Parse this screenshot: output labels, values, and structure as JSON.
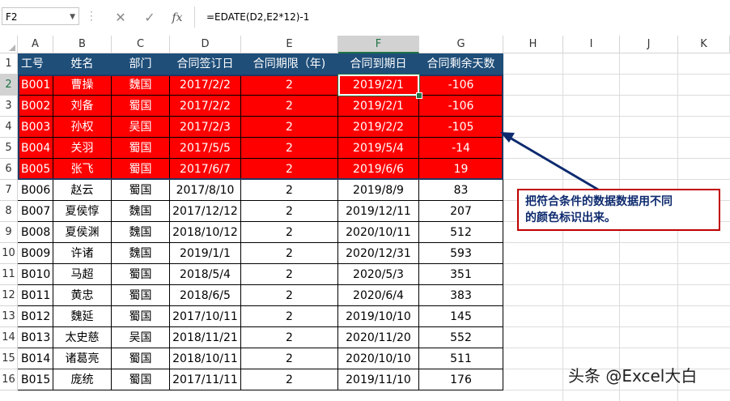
{
  "formula_bar": {
    "name_box": "F2",
    "cancel_icon": "✕",
    "enter_icon": "✓",
    "fx_label": "fx",
    "formula": "=EDATE(D2,E2*12)-1"
  },
  "columns": [
    "A",
    "B",
    "C",
    "D",
    "E",
    "F",
    "G",
    "H",
    "I",
    "J",
    "K"
  ],
  "rows": [
    "1",
    "2",
    "3",
    "4",
    "5",
    "6",
    "7",
    "8",
    "9",
    "10",
    "11",
    "12",
    "13",
    "14",
    "15",
    "16"
  ],
  "table": {
    "headers": [
      "工号",
      "姓名",
      "部门",
      "合同签订日",
      "合同期限（年)",
      "合同到期日",
      "合同剩余天数"
    ],
    "rows": [
      [
        "B001",
        "曹操",
        "魏国",
        "2017/2/2",
        "2",
        "2019/2/1",
        "-106"
      ],
      [
        "B002",
        "刘备",
        "蜀国",
        "2017/2/2",
        "2",
        "2019/2/1",
        "-106"
      ],
      [
        "B003",
        "孙权",
        "吴国",
        "2017/2/3",
        "2",
        "2019/2/2",
        "-105"
      ],
      [
        "B004",
        "关羽",
        "蜀国",
        "2017/5/5",
        "2",
        "2019/5/4",
        "-14"
      ],
      [
        "B005",
        "张飞",
        "蜀国",
        "2017/6/7",
        "2",
        "2019/6/6",
        "19"
      ],
      [
        "B006",
        "赵云",
        "蜀国",
        "2017/8/10",
        "2",
        "2019/8/9",
        "83"
      ],
      [
        "B007",
        "夏侯惇",
        "魏国",
        "2017/12/12",
        "2",
        "2019/12/11",
        "207"
      ],
      [
        "B008",
        "夏侯渊",
        "魏国",
        "2018/10/12",
        "2",
        "2020/10/11",
        "512"
      ],
      [
        "B009",
        "许诸",
        "魏国",
        "2019/1/1",
        "2",
        "2020/12/31",
        "593"
      ],
      [
        "B010",
        "马超",
        "蜀国",
        "2018/5/4",
        "2",
        "2020/5/3",
        "351"
      ],
      [
        "B011",
        "黄忠",
        "蜀国",
        "2018/6/5",
        "2",
        "2020/6/4",
        "383"
      ],
      [
        "B012",
        "魏延",
        "蜀国",
        "2017/10/11",
        "2",
        "2019/10/10",
        "145"
      ],
      [
        "B013",
        "太史慈",
        "吴国",
        "2018/11/21",
        "2",
        "2020/11/20",
        "552"
      ],
      [
        "B014",
        "诸葛亮",
        "蜀国",
        "2018/10/11",
        "2",
        "2020/10/10",
        "511"
      ],
      [
        "B015",
        "庞统",
        "蜀国",
        "2017/11/11",
        "2",
        "2019/11/10",
        "176"
      ]
    ]
  },
  "annotation": {
    "line1": "把符合条件的数据数据用不同",
    "line2": "的颜色标识出来。"
  },
  "watermark": "头条 @Excel大白",
  "colors": {
    "header_bg": "#1f4e79",
    "highlight": "#ff0000",
    "selection": "#217346"
  }
}
